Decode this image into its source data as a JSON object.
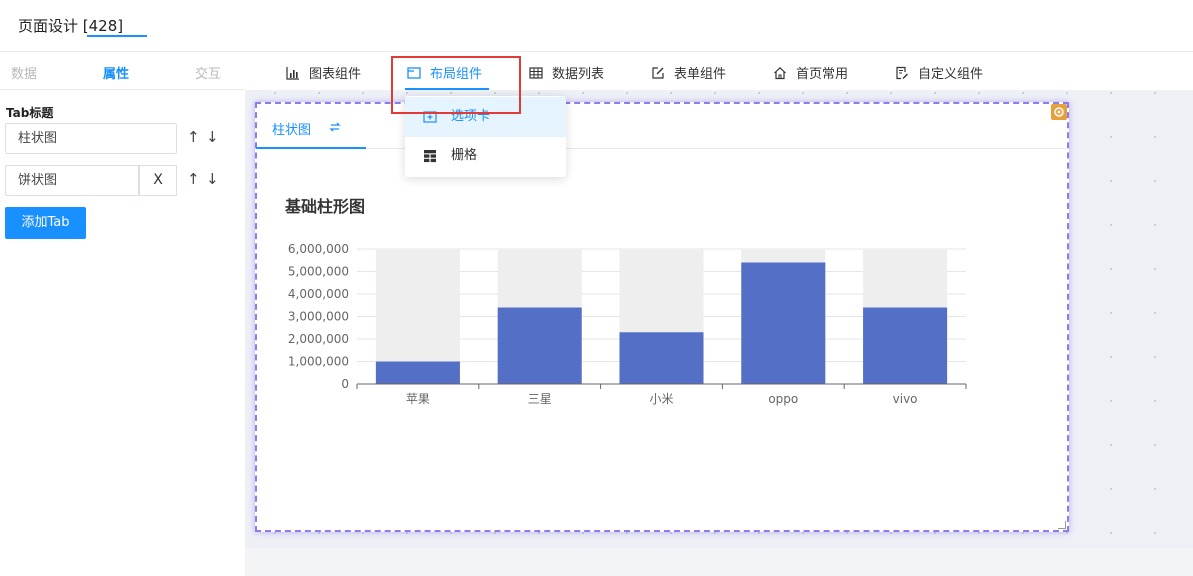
{
  "header": {
    "title": "页面设计 [428]"
  },
  "left_tabs": [
    {
      "label": "数据"
    },
    {
      "label": "属性"
    },
    {
      "label": "交互"
    }
  ],
  "props": {
    "section_title": "Tab标题",
    "tab_items": [
      {
        "value": "柱状图"
      },
      {
        "value": "饼状图",
        "delete_label": "X"
      }
    ],
    "add_button": "添加Tab"
  },
  "toolbar": {
    "items": [
      {
        "label": "图表组件",
        "icon": "bar-chart-icon"
      },
      {
        "label": "布局组件",
        "icon": "layout-window-icon"
      },
      {
        "label": "数据列表",
        "icon": "table-icon"
      },
      {
        "label": "表单组件",
        "icon": "edit-icon"
      },
      {
        "label": "首页常用",
        "icon": "home-icon"
      },
      {
        "label": "自定义组件",
        "icon": "custom-doc-icon"
      }
    ]
  },
  "dropdown": {
    "items": [
      {
        "label": "选项卡",
        "icon": "tab-add-icon"
      },
      {
        "label": "栅格",
        "icon": "grid-icon"
      }
    ]
  },
  "card": {
    "tab_label": "柱状图"
  },
  "chart_data": {
    "type": "bar",
    "title": "基础柱形图",
    "categories": [
      "苹果",
      "三星",
      "小米",
      "oppo",
      "vivo"
    ],
    "values": [
      1000000,
      3400000,
      2300000,
      5400000,
      3400000
    ],
    "ylim": [
      0,
      6000000
    ],
    "yticks": [
      "0",
      "1,000,000",
      "2,000,000",
      "3,000,000",
      "4,000,000",
      "5,000,000",
      "6,000,000"
    ],
    "bar_color": "#5470c6",
    "background_bar_color": "#eeeeee",
    "grid": true
  },
  "colors": {
    "accent": "#1890ff",
    "highlight_frame": "#e53935",
    "selection_border": "#8b7cf0"
  }
}
